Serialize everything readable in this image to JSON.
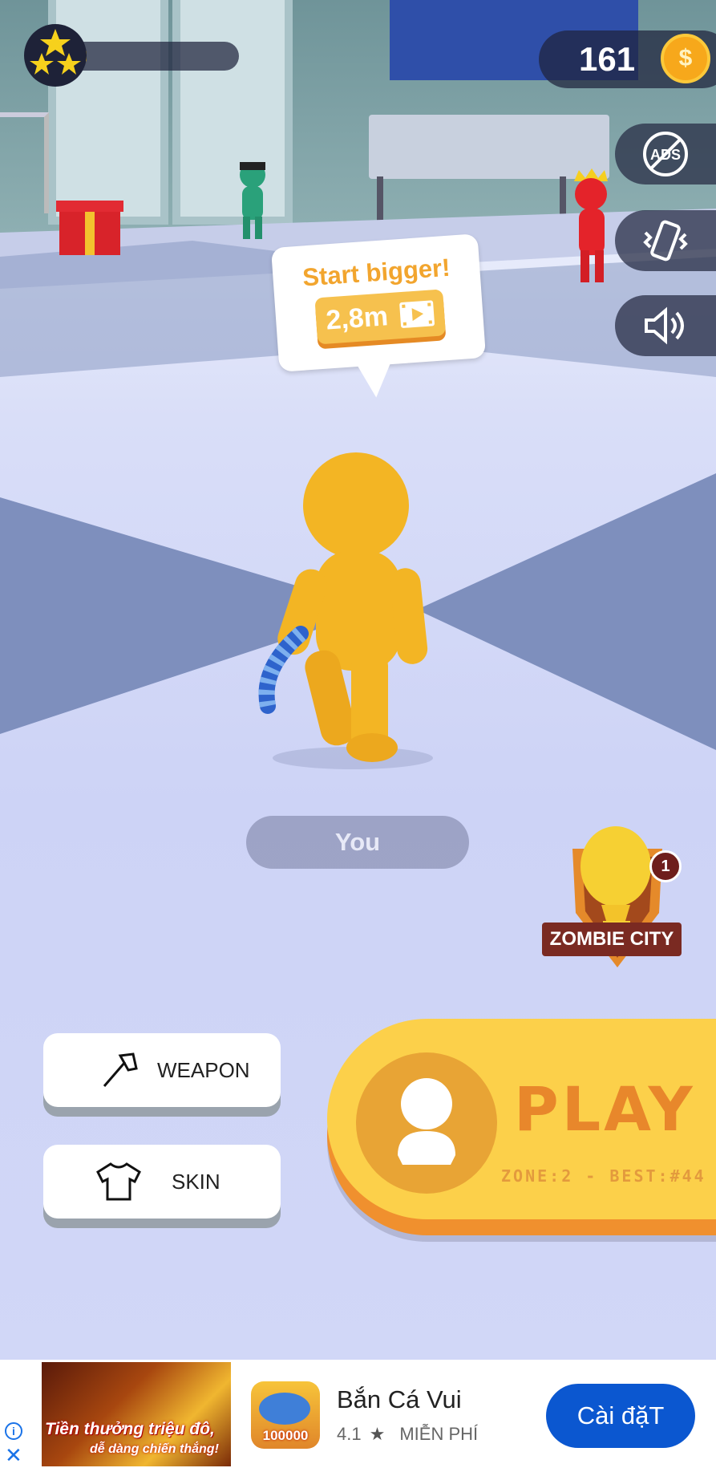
{
  "hud": {
    "stars_count": 3,
    "level_progress": 0.02,
    "coins": "161",
    "coin_symbol": "$"
  },
  "side_buttons": [
    "no-ads",
    "vibration",
    "sound"
  ],
  "speech_bubble": {
    "title": "Start bigger!",
    "button_label": "2,8m"
  },
  "player": {
    "name": "You"
  },
  "zone_badge": {
    "label": "ZOMBIE CITY",
    "count": "1"
  },
  "menu": {
    "weapon_label": "WEAPON",
    "skin_label": "SKIN"
  },
  "play": {
    "label": "PLAY",
    "zone_info": "ZONE:2 - BEST:#44"
  },
  "ad": {
    "banner_line1": "Tiền thưởng triệu đô,",
    "banner_line2": "dễ dàng chiến thắng!",
    "icon_text": "100000",
    "app_name": "Bắn Cá Vui",
    "rating": "4.1",
    "price": "MIỄN PHÍ",
    "install_label": "Cài đặT"
  },
  "colors": {
    "player": "#f3b524",
    "play_button": "#fcd04a",
    "play_text": "#e8872b",
    "install_button": "#0b57d0"
  }
}
